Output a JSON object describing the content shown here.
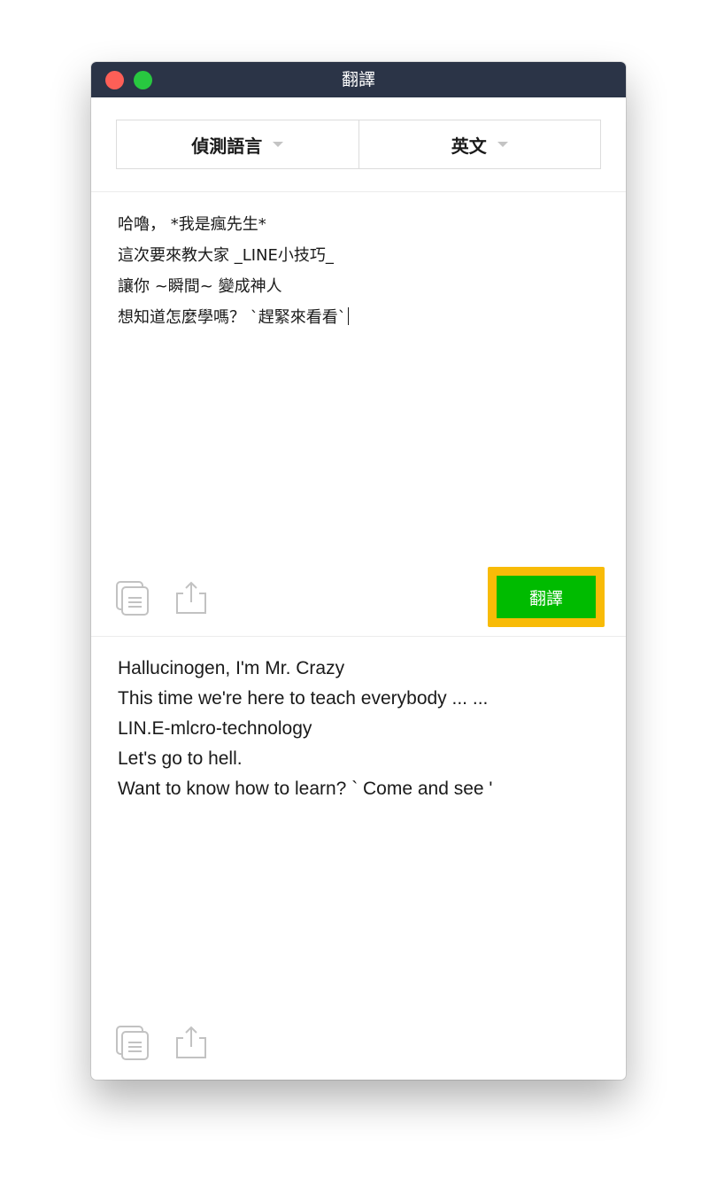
{
  "window": {
    "title": "翻譯"
  },
  "language_selector": {
    "source": "偵測語言",
    "target": "英文"
  },
  "source": {
    "lines": "哈嚕， *我是瘋先生*\n這次要來教大家 _LINE小技巧_\n讓你 ~瞬間~ 變成神人\n想知道怎麼學嗎？ `趕緊來看看`"
  },
  "translate_button": {
    "label": "翻譯"
  },
  "result": {
    "lines": "Hallucinogen, I'm Mr. Crazy\nThis time we're here to teach everybody ... ...\nLIN.E-mlcro-technology\nLet's go to hell.\nWant to know how to learn? ` Come and see '"
  },
  "icons": {
    "copy": "copy-icon",
    "share": "share-icon"
  },
  "colors": {
    "titlebar": "#2b3447",
    "close": "#fe5f57",
    "zoom": "#28c840",
    "translate_button": "#00bb00",
    "highlight": "#f8bb07"
  }
}
